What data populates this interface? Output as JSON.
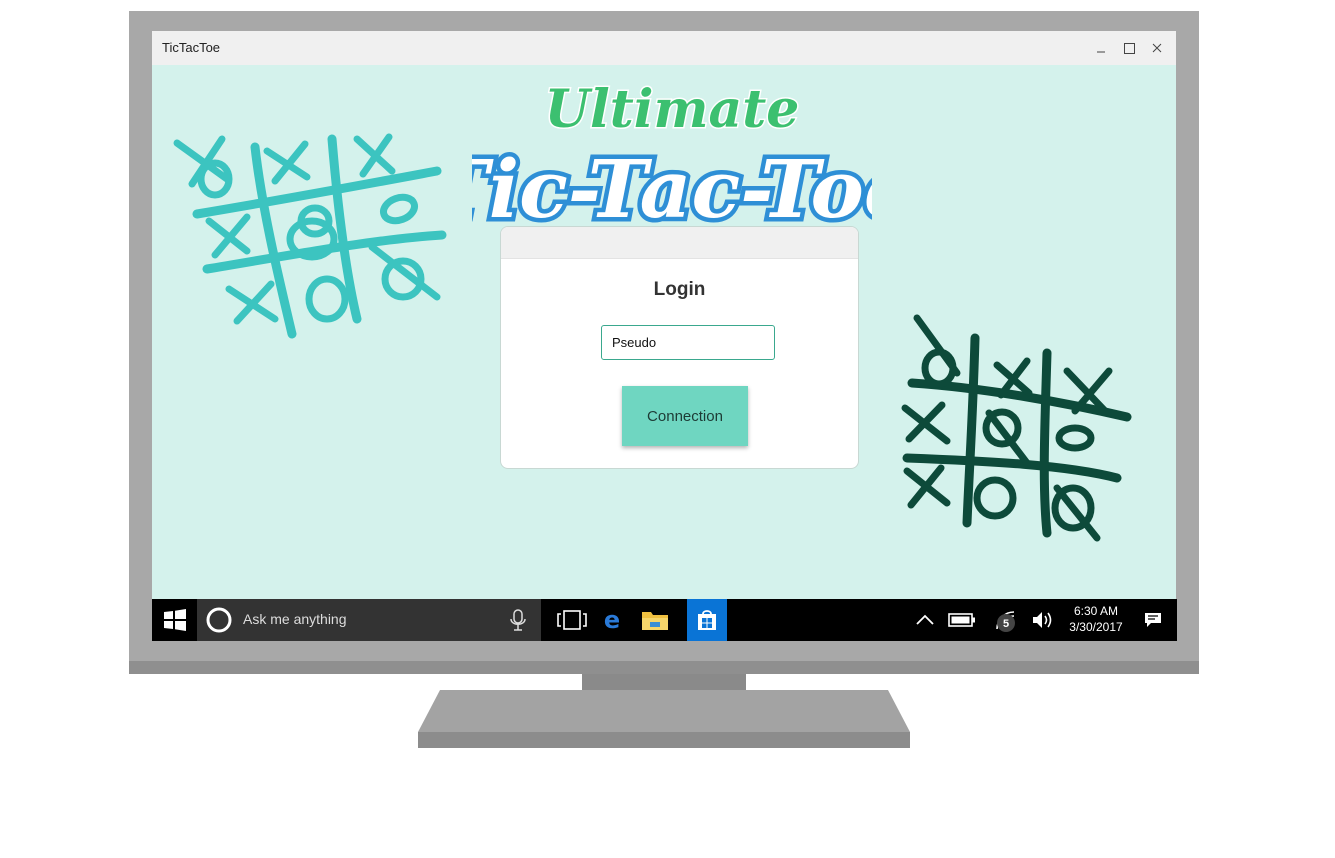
{
  "window": {
    "title": "TicTacToe"
  },
  "logo": {
    "line1": "Ultimate",
    "line2": "Tic-Tac-Toe"
  },
  "login": {
    "title": "Login",
    "pseudo_placeholder": "Pseudo",
    "pseudo_value": "",
    "button_label": "Connection"
  },
  "taskbar": {
    "search_placeholder": "Ask me anything",
    "time": "6:30 AM",
    "date": "3/30/2017",
    "notification_count": "5"
  },
  "colors": {
    "app_background": "#d4f2ec",
    "button": "#6fd6c1",
    "logo_green": "#3cc070",
    "logo_blue": "#2e8fd6",
    "grid_teal": "#3cc4c0",
    "grid_dark": "#0d4a3a"
  },
  "icons": [
    "minimize-icon",
    "maximize-icon",
    "close-icon",
    "windows-start-icon",
    "cortana-icon",
    "microphone-icon",
    "task-view-icon",
    "edge-icon",
    "file-explorer-icon",
    "store-icon",
    "chevron-up-icon",
    "battery-icon",
    "wifi-icon",
    "volume-icon",
    "action-center-icon"
  ]
}
